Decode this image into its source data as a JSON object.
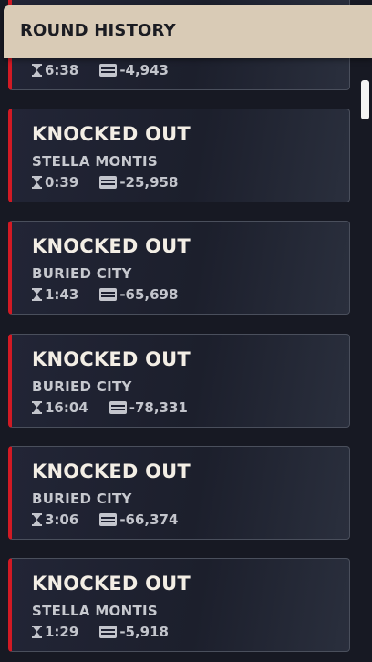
{
  "header": {
    "title": "ROUND HISTORY"
  },
  "rounds": [
    {
      "outcome": "",
      "map": "",
      "duration": "6:38",
      "value": "-4,943"
    },
    {
      "outcome": "KNOCKED OUT",
      "map": "STELLA MONTIS",
      "duration": "0:39",
      "value": "-25,958"
    },
    {
      "outcome": "KNOCKED OUT",
      "map": "BURIED CITY",
      "duration": "1:43",
      "value": "-65,698"
    },
    {
      "outcome": "KNOCKED OUT",
      "map": "BURIED CITY",
      "duration": "16:04",
      "value": "-78,331"
    },
    {
      "outcome": "KNOCKED OUT",
      "map": "BURIED CITY",
      "duration": "3:06",
      "value": "-66,374"
    },
    {
      "outcome": "KNOCKED OUT",
      "map": "STELLA MONTIS",
      "duration": "1:29",
      "value": "-5,918"
    }
  ],
  "icons": {
    "duration": "hourglass-icon",
    "value": "loot-box-icon"
  },
  "colors": {
    "header_bg": "#d9cbb6",
    "accent": "#d11a24",
    "card_bg": "#1f2230"
  }
}
